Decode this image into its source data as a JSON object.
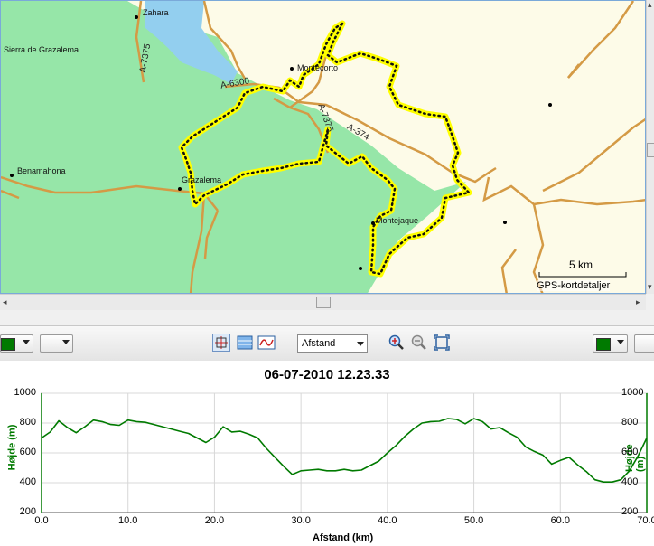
{
  "map": {
    "places": [
      {
        "key": "zahara",
        "label": "Zahara"
      },
      {
        "key": "grazalema_sierra",
        "label": "Sierra de Grazalema"
      },
      {
        "key": "montecorto",
        "label": "Montecorto"
      },
      {
        "key": "benamahona",
        "label": "Benamahona"
      },
      {
        "key": "grazalema",
        "label": "Grazalema"
      },
      {
        "key": "montejaque",
        "label": "Montejaque"
      }
    ],
    "roads": [
      "A-7375",
      "A-6300",
      "A-7375",
      "A-374"
    ],
    "scale_label": "5 km",
    "credit": "GPS-kortdetaljer",
    "colors": {
      "park": "#96e6a8",
      "land": "#fdfbe8",
      "water": "#93cfef",
      "road": "#d49a45",
      "track": "#ffff00"
    }
  },
  "toolbar": {
    "color_left": "#007a00",
    "color_right": "#007a00",
    "axis_select": "Afstand",
    "icons": [
      "crosshair-icon",
      "list-view-icon",
      "graph-icon",
      "zoom-in-icon",
      "zoom-out-icon",
      "zoom-fit-icon"
    ]
  },
  "chart_data": {
    "type": "line",
    "title": "06-07-2010 12.23.33",
    "xlabel": "Afstand (km)",
    "ylabel": "Højde (m)",
    "xlim": [
      0,
      70
    ],
    "ylim": [
      200,
      1000
    ],
    "xticks": [
      "0.0",
      "10.0",
      "20.0",
      "30.0",
      "40.0",
      "50.0",
      "60.0",
      "70.0"
    ],
    "yticks": [
      "1000",
      "800",
      "600",
      "400",
      "200"
    ],
    "line_color": "#007a00",
    "series": [
      {
        "x": [
          0,
          1,
          2,
          3,
          4,
          5,
          6,
          7,
          8,
          9,
          10,
          11,
          12,
          13,
          14,
          15,
          16,
          17,
          18,
          19,
          20,
          21,
          22,
          23,
          24,
          25,
          26,
          27,
          28,
          29,
          30,
          31,
          32,
          33,
          34,
          35,
          36,
          37,
          38,
          39,
          40,
          41,
          42,
          43,
          44,
          45,
          46,
          47,
          48,
          49,
          50,
          51,
          52,
          53,
          54,
          55,
          56,
          57,
          58,
          59,
          60,
          61,
          62,
          63,
          64,
          65,
          66,
          67,
          68,
          69,
          70
        ],
        "y": [
          700,
          740,
          815,
          770,
          735,
          775,
          820,
          810,
          790,
          785,
          820,
          810,
          805,
          790,
          775,
          760,
          745,
          730,
          700,
          670,
          705,
          775,
          740,
          745,
          725,
          700,
          630,
          570,
          510,
          455,
          480,
          485,
          490,
          480,
          480,
          490,
          480,
          485,
          515,
          545,
          600,
          650,
          710,
          760,
          800,
          810,
          812,
          830,
          825,
          795,
          830,
          810,
          760,
          770,
          735,
          705,
          640,
          610,
          585,
          525,
          550,
          570,
          520,
          475,
          420,
          405,
          405,
          420,
          480,
          580,
          700
        ]
      }
    ]
  }
}
